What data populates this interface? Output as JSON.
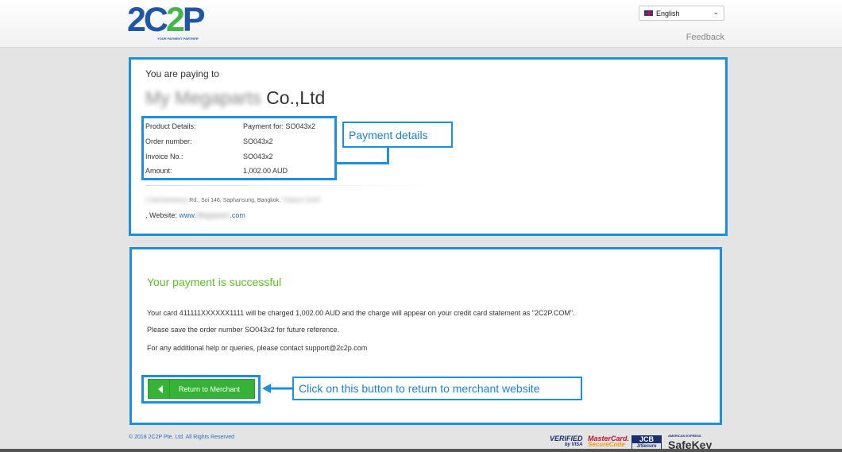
{
  "header": {
    "logo_part1": "2C",
    "logo_part2": "2",
    "logo_part3": "P",
    "logo_tagline": "YOUR PAYMENT PARTNER",
    "language_selected": "English",
    "feedback_label": "Feedback"
  },
  "merchant_card": {
    "paying_to_label": "You are paying to",
    "merchant_name_blurred": "My Megaparts",
    "merchant_name_suffix": "Co.,Ltd",
    "details": [
      {
        "label": "Product Details:",
        "value": "Payment for: SO043x2"
      },
      {
        "label": "Order number:",
        "value": "SO043x2"
      },
      {
        "label": "Invoice No.:",
        "value": "SO043x2"
      },
      {
        "label": "Amount:",
        "value": "1,002.00 AUD"
      }
    ],
    "address_blurred_1": "2 Ratchamhaeng",
    "address_mid": "Rd., Soi 146, Saphansung, Bangkok,",
    "address_blurred_2": "Thailand 10240",
    "website_prefix": ", Website: ",
    "website_link_start": "www.",
    "website_link_blurred": "Megaparts",
    "website_link_end": ".com"
  },
  "result_card": {
    "title": "Your payment is successful",
    "message_1": "Your card 411111XXXXXX1111 will be charged 1,002.00 AUD and the charge will appear on your credit card statement as \"2C2P.COM\".",
    "message_2": "Please save the order number SO043x2 for future reference.",
    "message_3": "For any additional help or queries, please contact support@2c2p.com",
    "return_button_label": "Return to Merchant"
  },
  "annotations": {
    "payment_details_label": "Payment details",
    "button_hint_label": "Click on this button to return to merchant website"
  },
  "footer": {
    "copyright": "© 2018 2C2P Pte. Ltd. All Rights Reserved",
    "badge_vbv_1": "VERIFIED",
    "badge_vbv_2": "by VISA",
    "badge_mc_1": "MasterCard.",
    "badge_mc_2": "SecureCode",
    "badge_jcb_1": "JCB",
    "badge_jcb_2": "J/Secure",
    "badge_amex_1": "AMERICAN EXPRESS",
    "badge_amex_2": "SafeKey"
  },
  "colors": {
    "accent_blue": "#1d8fe1",
    "success_green": "#5cbf2a",
    "button_green": "#36b236",
    "logo_blue": "#1f56a8",
    "logo_green": "#43b649"
  }
}
